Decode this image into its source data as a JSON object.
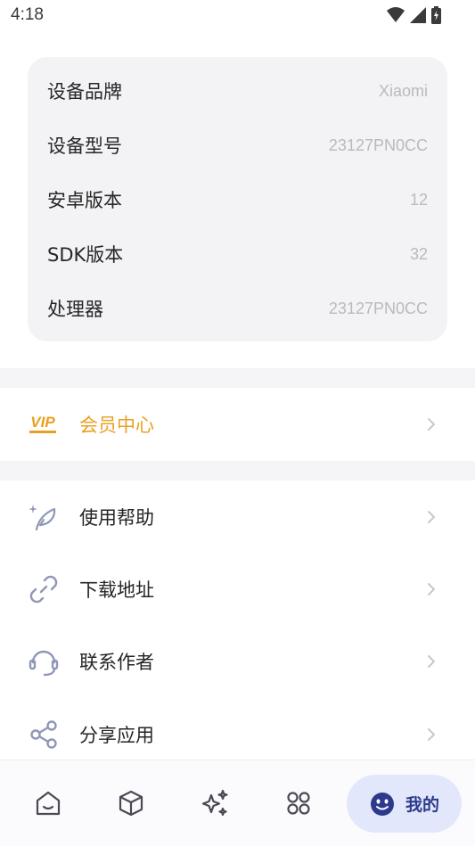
{
  "status_bar": {
    "time": "4:18"
  },
  "device_info": [
    {
      "label": "设备品牌",
      "value": "Xiaomi"
    },
    {
      "label": "设备型号",
      "value": "23127PN0CC"
    },
    {
      "label": "安卓版本",
      "value": "12"
    },
    {
      "label": "SDK版本",
      "value": "32"
    },
    {
      "label": "处理器",
      "value": "23127PN0CC"
    }
  ],
  "vip": {
    "badge": "VIP",
    "label": "会员中心"
  },
  "menu": [
    {
      "label": "使用帮助",
      "icon": "feather-icon"
    },
    {
      "label": "下载地址",
      "icon": "link-icon"
    },
    {
      "label": "联系作者",
      "icon": "headset-icon"
    },
    {
      "label": "分享应用",
      "icon": "share-icon"
    }
  ],
  "bottom_nav": {
    "items": [
      "home-icon",
      "cube-icon",
      "sparkles-icon",
      "apps-grid-icon"
    ],
    "active_label": "我的"
  },
  "colors": {
    "accent": "#2d3a8c",
    "vip": "#e9a021",
    "card_bg": "#f3f3f5",
    "icon": "#8f97b8"
  }
}
